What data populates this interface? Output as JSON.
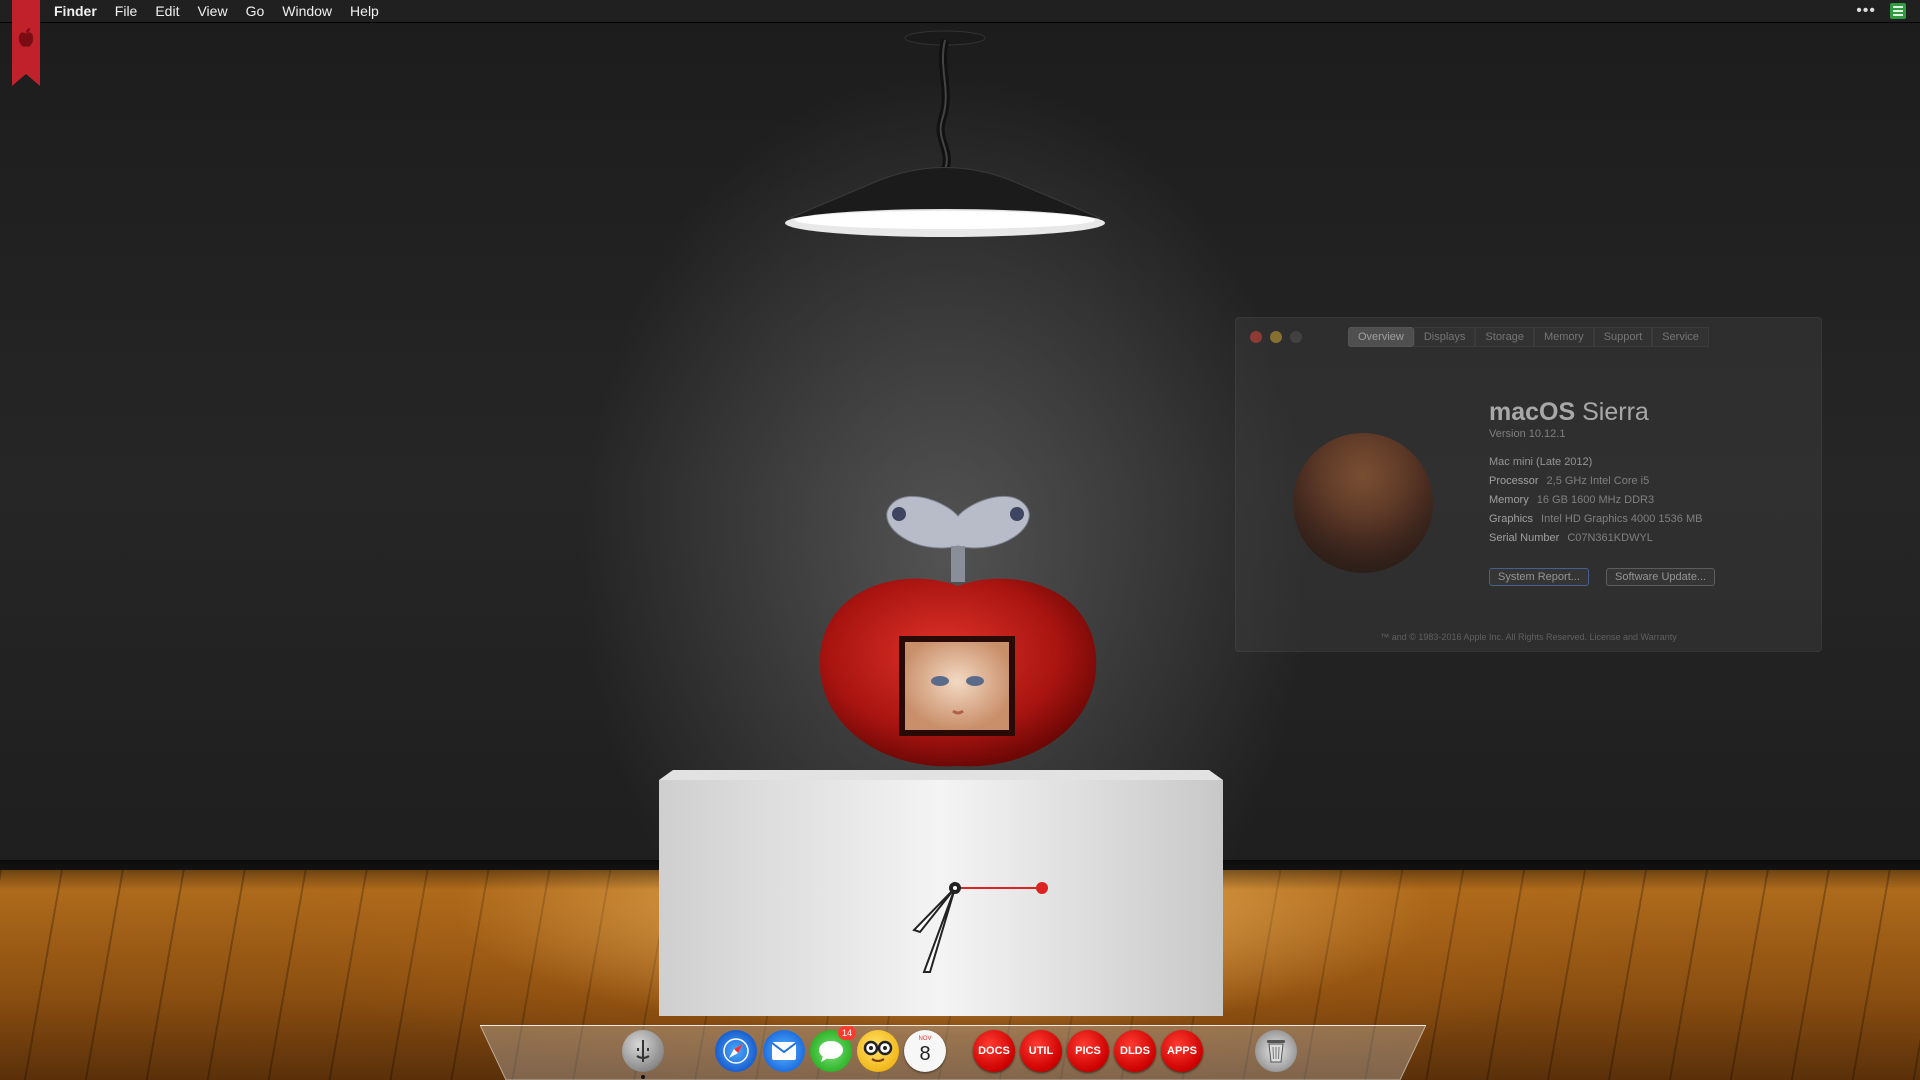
{
  "menubar": {
    "app_name": "Finder",
    "items": [
      "File",
      "Edit",
      "View",
      "Go",
      "Window",
      "Help"
    ],
    "icons": {
      "apple": "apple-logo-icon",
      "more": "ellipsis-icon",
      "status": "list-status-icon"
    },
    "colors": {
      "ribbon": "#c0212b",
      "status_icon": "#2f9a40"
    }
  },
  "about_window": {
    "tabs": [
      "Overview",
      "Displays",
      "Storage",
      "Memory",
      "Support",
      "Service"
    ],
    "active_tab": "Overview",
    "title_bold": "macOS",
    "title_rest": "Sierra",
    "version": "Version 10.12.1",
    "model": "Mac mini (Late 2012)",
    "specs": [
      {
        "key": "Processor",
        "value": "2,5 GHz Intel Core i5"
      },
      {
        "key": "Memory",
        "value": "16 GB 1600 MHz DDR3"
      },
      {
        "key": "Graphics",
        "value": "Intel HD Graphics 4000 1536 MB"
      },
      {
        "key": "Serial Number",
        "value": "C07N361KDWYL"
      }
    ],
    "buttons": {
      "system_report": "System Report...",
      "software_update": "Software Update..."
    },
    "footer": "™ and © 1983-2016 Apple Inc. All Rights Reserved. License and Warranty"
  },
  "dock": {
    "apps": [
      {
        "name": "finder-icon"
      },
      {
        "name": "safari-icon"
      },
      {
        "name": "mail-icon"
      },
      {
        "name": "messages-icon",
        "badge": "14"
      },
      {
        "name": "nerd-face-icon"
      },
      {
        "name": "calendar-icon",
        "month": "NOV",
        "day": "8"
      }
    ],
    "folders": [
      "DOCS",
      "UTIL",
      "PICS",
      "DLDS",
      "APPS"
    ],
    "trash": "trash-icon",
    "colors": {
      "folder": "#e0161b",
      "badge": "#ff3b30"
    }
  }
}
